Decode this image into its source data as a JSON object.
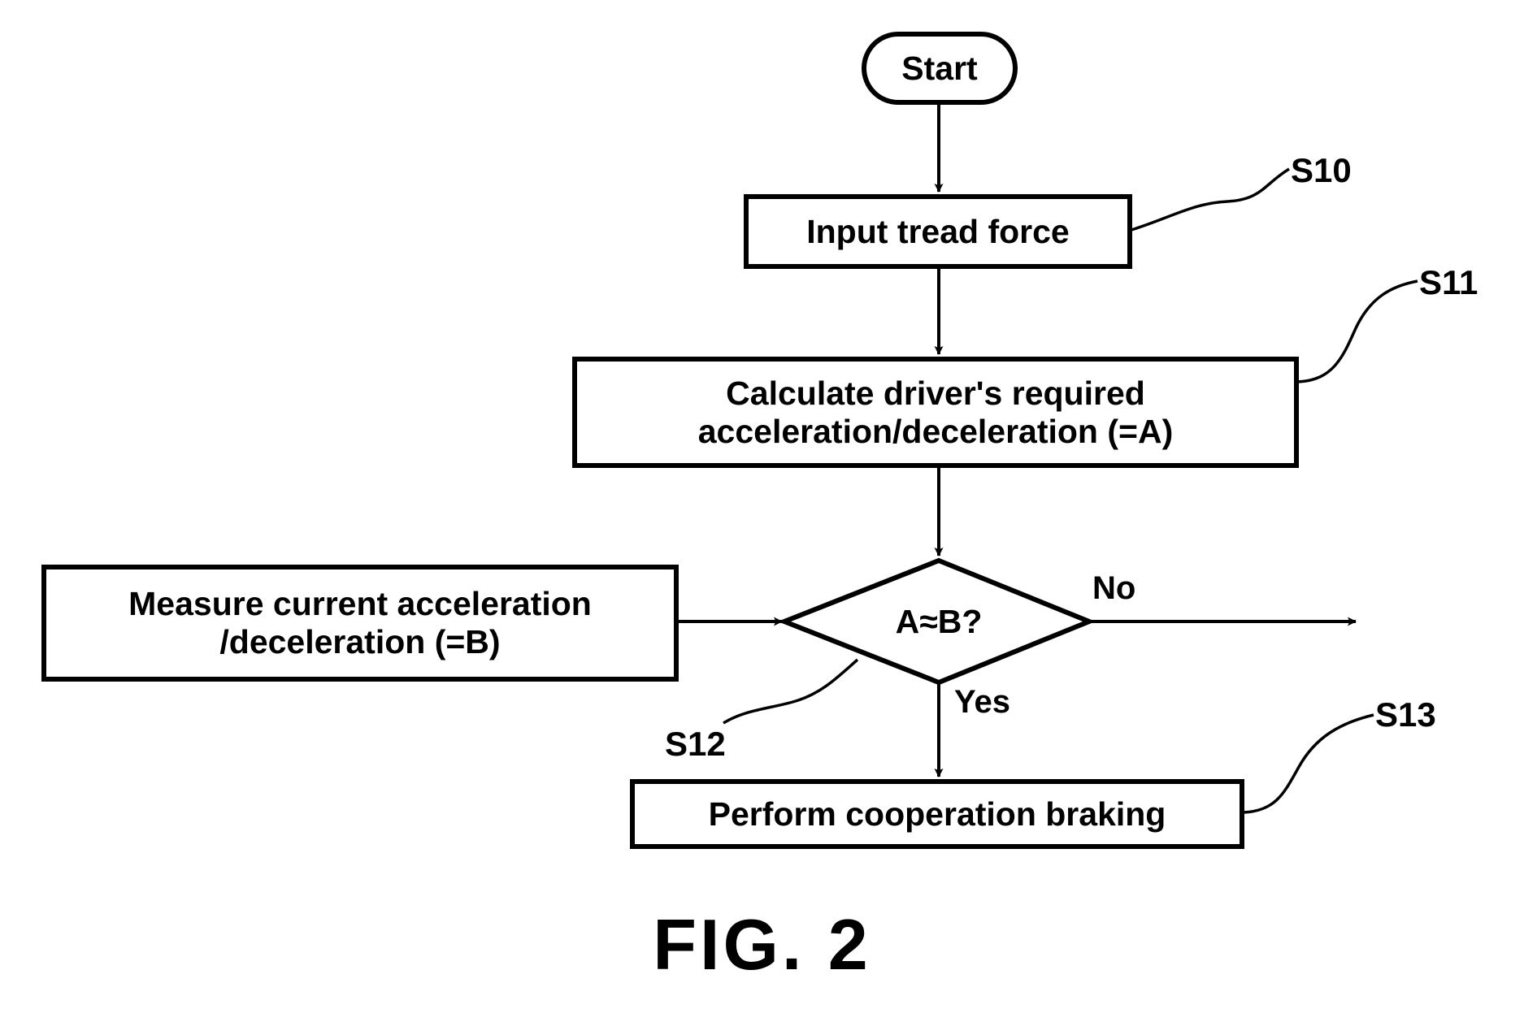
{
  "figure": {
    "caption": "FIG. 2",
    "type": "flowchart"
  },
  "nodes": [
    {
      "id": "start",
      "shape": "terminator",
      "label": "Start"
    },
    {
      "id": "s10",
      "shape": "process",
      "label": "Input tread force"
    },
    {
      "id": "s11",
      "shape": "process",
      "label": "Calculate driver's required\nacceleration/deceleration (=A)"
    },
    {
      "id": "s12",
      "shape": "process",
      "label": "Measure current acceleration\n/deceleration (=B)"
    },
    {
      "id": "decision",
      "shape": "decision",
      "label": "A≈B?"
    },
    {
      "id": "s13",
      "shape": "process",
      "label": "Perform cooperation braking"
    }
  ],
  "reference_labels": [
    {
      "id": "S10",
      "text": "S10",
      "points_to": "s10"
    },
    {
      "id": "S11",
      "text": "S11",
      "points_to": "s11"
    },
    {
      "id": "S12",
      "text": "S12",
      "points_to": "decision"
    },
    {
      "id": "S13",
      "text": "S13",
      "points_to": "s13"
    }
  ],
  "branch_labels": [
    {
      "id": "no",
      "text": "No",
      "from": "decision"
    },
    {
      "id": "yes",
      "text": "Yes",
      "from": "decision"
    }
  ],
  "colors": {
    "line": "#000000",
    "text": "#000000",
    "background": "#ffffff"
  }
}
